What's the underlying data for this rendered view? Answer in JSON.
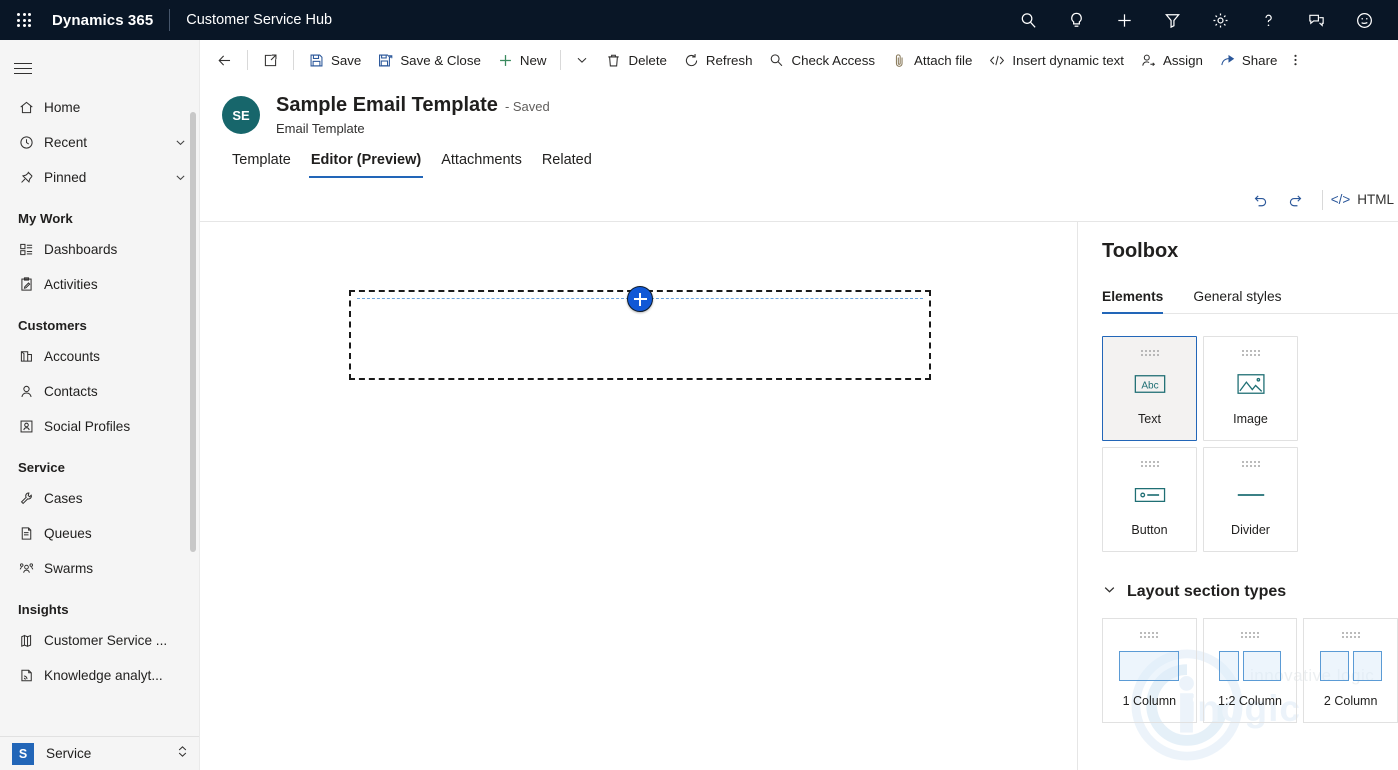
{
  "appbar": {
    "waffle_label": "app-launcher",
    "brand": "Dynamics 365",
    "app_name": "Customer Service Hub",
    "icons": [
      {
        "name": "search-icon",
        "label": "Search"
      },
      {
        "name": "lightbulb-icon",
        "label": "Insights"
      },
      {
        "name": "plus-icon",
        "label": "Quick create"
      },
      {
        "name": "filter-icon",
        "label": "Filter"
      },
      {
        "name": "gear-icon",
        "label": "Settings"
      },
      {
        "name": "help-icon",
        "label": "Help"
      },
      {
        "name": "chat-icon",
        "label": "Feedback"
      },
      {
        "name": "smiley-icon",
        "label": "Profile"
      }
    ]
  },
  "sidebar": {
    "items": [
      {
        "label": "Home",
        "icon": "home-icon",
        "chevron": false
      },
      {
        "label": "Recent",
        "icon": "clock-icon",
        "chevron": true
      },
      {
        "label": "Pinned",
        "icon": "pin-icon",
        "chevron": true
      }
    ],
    "groups": [
      {
        "title": "My Work",
        "items": [
          {
            "label": "Dashboards",
            "icon": "dashboard-icon"
          },
          {
            "label": "Activities",
            "icon": "activities-icon"
          }
        ]
      },
      {
        "title": "Customers",
        "items": [
          {
            "label": "Accounts",
            "icon": "accounts-icon"
          },
          {
            "label": "Contacts",
            "icon": "contacts-icon"
          },
          {
            "label": "Social Profiles",
            "icon": "social-profile-icon"
          }
        ]
      },
      {
        "title": "Service",
        "items": [
          {
            "label": "Cases",
            "icon": "cases-icon"
          },
          {
            "label": "Queues",
            "icon": "queues-icon"
          },
          {
            "label": "Swarms",
            "icon": "swarms-icon"
          }
        ]
      },
      {
        "title": "Insights",
        "items": [
          {
            "label": "Customer Service ...",
            "icon": "insights-icon"
          },
          {
            "label": "Knowledge analyt...",
            "icon": "knowledge-icon"
          }
        ]
      }
    ],
    "area_switcher": {
      "badge": "S",
      "label": "Service"
    }
  },
  "commandbar": {
    "back_label": "Back",
    "popout_label": "Open in new window",
    "items": [
      {
        "label": "Save",
        "icon": "save-icon"
      },
      {
        "label": "Save & Close",
        "icon": "save-close-icon"
      },
      {
        "label": "New",
        "icon": "plus-icon"
      },
      {
        "label": "Delete",
        "icon": "trash-icon"
      },
      {
        "label": "Refresh",
        "icon": "refresh-icon"
      },
      {
        "label": "Check Access",
        "icon": "check-access-icon"
      },
      {
        "label": "Attach file",
        "icon": "paperclip-icon"
      },
      {
        "label": "Insert dynamic text",
        "icon": "code-icon"
      },
      {
        "label": "Assign",
        "icon": "assign-icon"
      },
      {
        "label": "Share",
        "icon": "share-icon"
      }
    ],
    "overflow_label": "More commands"
  },
  "record": {
    "avatar_initials": "SE",
    "title": "Sample Email Template",
    "status": "- Saved",
    "subtitle": "Email Template",
    "tabs": [
      {
        "label": "Template",
        "active": false
      },
      {
        "label": "Editor (Preview)",
        "active": true
      },
      {
        "label": "Attachments",
        "active": false
      },
      {
        "label": "Related",
        "active": false
      }
    ]
  },
  "editor_toolbar": {
    "undo_label": "Undo",
    "redo_label": "Redo",
    "html_label": "HTML",
    "code_glyph": "</>"
  },
  "canvas": {
    "add_button_label": "Add section"
  },
  "toolbox": {
    "title": "Toolbox",
    "tabs": [
      {
        "label": "Elements",
        "active": true
      },
      {
        "label": "General styles",
        "active": false
      }
    ],
    "elements": [
      {
        "label": "Text",
        "icon": "text-abc-icon",
        "selected": true
      },
      {
        "label": "Image",
        "icon": "image-icon",
        "selected": false
      },
      {
        "label": "Button",
        "icon": "button-icon",
        "selected": false
      },
      {
        "label": "Divider",
        "icon": "divider-icon",
        "selected": false
      }
    ],
    "layout_section": {
      "title": "Layout section types",
      "expanded": true,
      "items": [
        {
          "label": "1 Column",
          "columns": [
            1
          ]
        },
        {
          "label": "1:2 Column",
          "columns": [
            1,
            2
          ]
        },
        {
          "label": "2 Column",
          "columns": [
            1,
            1
          ]
        }
      ]
    }
  },
  "watermark": {
    "tagline": "innovative logic",
    "brand": "inogic"
  },
  "colors": {
    "appbar_bg": "#091626",
    "accent_blue": "#2266b8",
    "avatar_teal": "#17666b",
    "element_icon_teal": "#1f6f74",
    "sidebar_bg": "#f5f5f5",
    "add_button_blue": "#1158d6"
  }
}
